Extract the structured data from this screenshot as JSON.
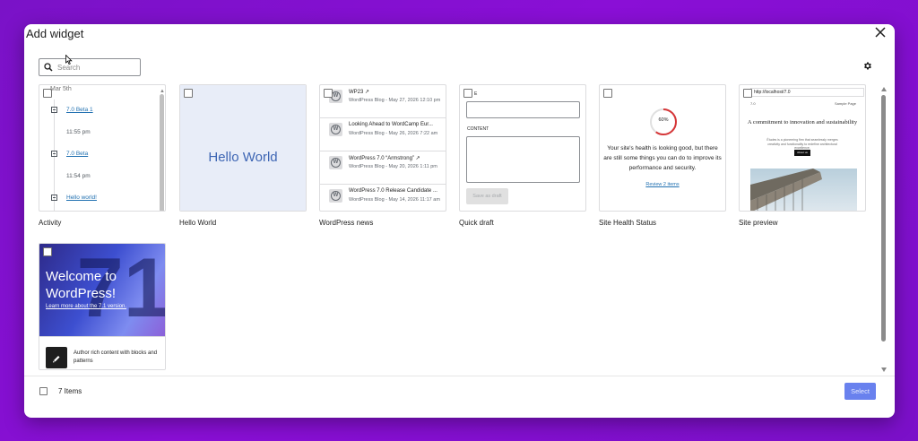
{
  "dialog": {
    "title": "Add widget",
    "search_placeholder": "Search",
    "item_count": "7 Items",
    "select_label": "Select"
  },
  "widgets": [
    {
      "label": "Activity",
      "date": "Mar 5th",
      "entries": [
        {
          "text": "7.0 Beta 1",
          "type": "link"
        },
        {
          "text": "11:55 pm",
          "type": "time"
        },
        {
          "text": "7.0 Beta",
          "type": "link"
        },
        {
          "text": "11:54 pm",
          "type": "time"
        },
        {
          "text": "Hello world!",
          "type": "link"
        }
      ]
    },
    {
      "label": "Hello World",
      "preview_text": "Hello World"
    },
    {
      "label": "WordPress news",
      "items": [
        {
          "title": "WP23 ↗",
          "meta": "WordPress Blog - May 27, 2026 12:10 pm"
        },
        {
          "title": "Looking Ahead to WordCamp Eur...",
          "meta": "WordPress Blog - May 26, 2026 7:22 am"
        },
        {
          "title": "WordPress 7.0 “Armstrong” ↗",
          "meta": "WordPress Blog - May 20, 2026 1:11 pm"
        },
        {
          "title": "WordPress 7.0 Release Candidate ...",
          "meta": "WordPress Blog - May 14, 2026 11:17 am"
        }
      ]
    },
    {
      "label": "Quick draft",
      "title_letter": "E",
      "content_label": "CONTENT",
      "button": "Save as draft"
    },
    {
      "label": "Site Health Status",
      "percent": "60%",
      "percent_value": 60,
      "message": "Your site's health is looking good, but there are still some things you can do to improve its performance and security.",
      "link": "Review 2 items"
    },
    {
      "label": "Site preview",
      "url": "http://localhost/7.0",
      "nav_left": "7.0",
      "nav_right": "Sample Page",
      "headline": "A commitment to innovation and sustainability",
      "subtext": "Études is a pioneering firm that seamlessly merges creativity and functionality to redefine architectural excellence.",
      "cta": "About us"
    },
    {
      "label": "",
      "hero_title": "Welcome to WordPress!",
      "hero_link": "Learn more about the 7.1 version.",
      "footer_text": "Author rich content with blocks and patterns"
    }
  ],
  "colors": {
    "accent": "#3858e9",
    "link": "#2271b1",
    "background": "#8a0fd6"
  }
}
